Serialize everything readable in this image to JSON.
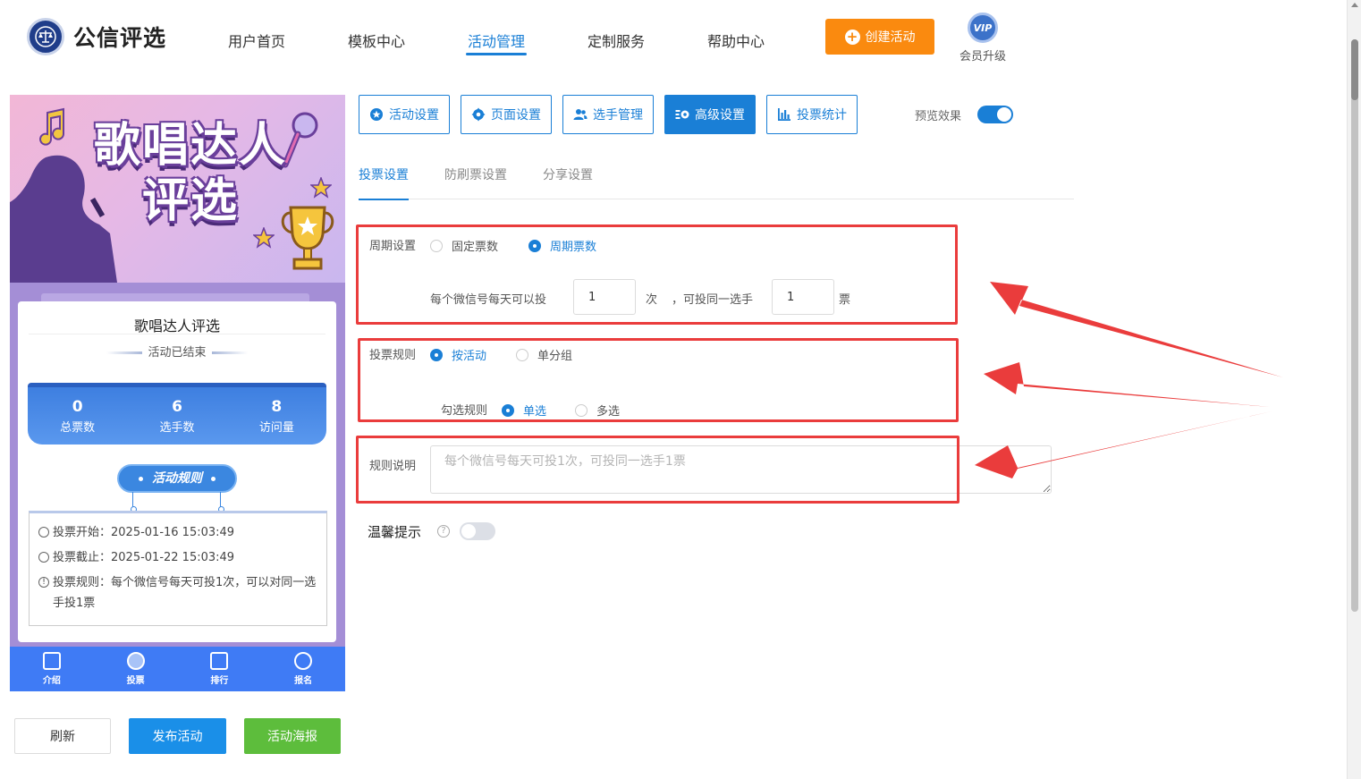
{
  "header": {
    "logo_text": "公信评选",
    "nav": [
      "用户首页",
      "模板中心",
      "活动管理",
      "定制服务",
      "帮助中心"
    ],
    "active_nav": 2,
    "create_label": "创建活动",
    "vip_badge": "VIP",
    "vip_label": "会员升级"
  },
  "preview": {
    "banner_title_line1": "歌唱达人",
    "banner_title_line2": "评选",
    "card_title": "歌唱达人评选",
    "status": "活动已结束",
    "stats": [
      {
        "value": "0",
        "label": "总票数"
      },
      {
        "value": "6",
        "label": "选手数"
      },
      {
        "value": "8",
        "label": "访问量"
      }
    ],
    "rules_button": "活动规则",
    "rules": [
      "投票开始：2025-01-16 15:03:49",
      "投票截止：2025-01-22 15:03:49",
      "投票规则：每个微信号每天可投1次，可以对同一选手投1票"
    ],
    "tabs": [
      "介绍",
      "投票",
      "排行",
      "报名"
    ]
  },
  "actions": {
    "refresh": "刷新",
    "publish": "发布活动",
    "poster": "活动海报"
  },
  "settings_tabs": [
    "活动设置",
    "页面设置",
    "选手管理",
    "高级设置",
    "投票统计"
  ],
  "active_settings_tab": 3,
  "preview_toggle": {
    "label": "预览效果",
    "on": true
  },
  "subtabs": [
    "投票设置",
    "防刷票设置",
    "分享设置"
  ],
  "period": {
    "label": "周期设置",
    "options": [
      "固定票数",
      "周期票数"
    ],
    "selected": 1,
    "text_before": "每个微信号每天可以投",
    "times_value": "1",
    "times_unit": "次",
    "text_mid": "，可投同一选手",
    "votes_value": "1",
    "votes_unit": "票"
  },
  "rule": {
    "label": "投票规则",
    "options": [
      "按活动",
      "单分组"
    ],
    "selected": 0,
    "check_label": "勾选规则",
    "check_options": [
      "单选",
      "多选"
    ],
    "check_selected": 0
  },
  "desc": {
    "label": "规则说明",
    "placeholder": "每个微信号每天可投1次，可投同一选手1票"
  },
  "warm": {
    "label": "温馨提示",
    "on": false
  },
  "colors": {
    "primary": "#1a7fd6",
    "orange": "#fa8a0f",
    "green": "#5dbd3c",
    "highlight": "#ea3c3c"
  }
}
